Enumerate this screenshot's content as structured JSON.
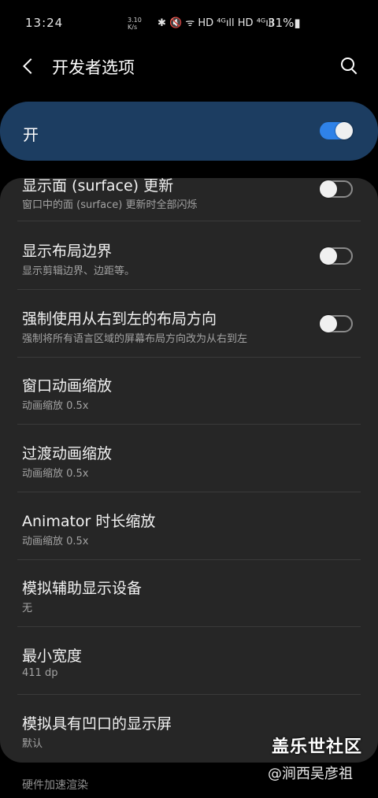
{
  "status_bar": {
    "time": "13:24",
    "net_speed_value": "3.10",
    "net_speed_unit": "K/s",
    "icons": "✱ 🔇 ᯤ HD ⁴ᴳıll HD ⁴ᴳıll",
    "battery": "31%▮"
  },
  "header": {
    "title": "开发者选项"
  },
  "master_toggle": {
    "label": "开",
    "on": true,
    "accent_color": "#2f82e8"
  },
  "settings": [
    {
      "title": "显示面 (surface) 更新",
      "subtitle": "窗口中的面 (surface) 更新时全部闪烁",
      "toggle": true,
      "on": false
    },
    {
      "title": "显示布局边界",
      "subtitle": "显示剪辑边界、边距等。",
      "toggle": true,
      "on": false
    },
    {
      "title": "强制使用从右到左的布局方向",
      "subtitle": "强制将所有语言区域的屏幕布局方向改为从右到左",
      "toggle": true,
      "on": false
    },
    {
      "title": "窗口动画缩放",
      "subtitle": "动画缩放 0.5x",
      "toggle": false
    },
    {
      "title": "过渡动画缩放",
      "subtitle": "动画缩放 0.5x",
      "toggle": false
    },
    {
      "title": "Animator 时长缩放",
      "subtitle": "动画缩放 0.5x",
      "toggle": false
    },
    {
      "title": "模拟辅助显示设备",
      "subtitle": "无",
      "toggle": false
    },
    {
      "title": "最小宽度",
      "subtitle": "411 dp",
      "toggle": false
    },
    {
      "title": "模拟具有凹口的显示屏",
      "subtitle": "默认",
      "toggle": false
    }
  ],
  "section_header": "硬件加速渲染",
  "watermark": {
    "line1": "盖乐世社区",
    "line2": "@涧西吴彦祖"
  }
}
